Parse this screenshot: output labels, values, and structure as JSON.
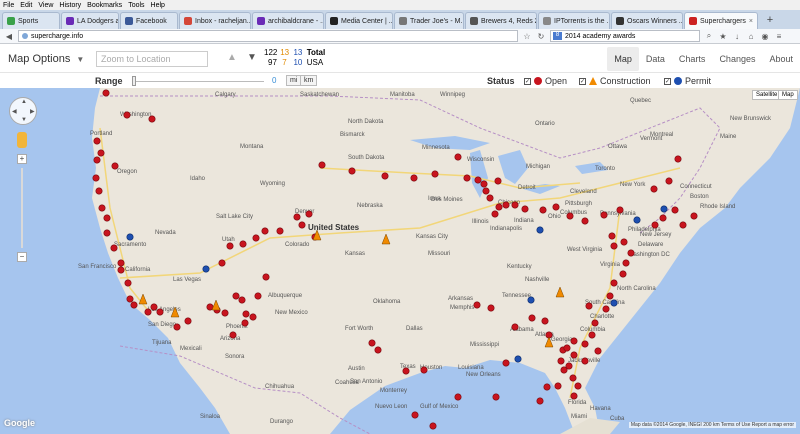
{
  "menu": [
    "File",
    "Edit",
    "View",
    "History",
    "Bookmarks",
    "Tools",
    "Help"
  ],
  "tabs": [
    {
      "label": "Sports",
      "color": "#3aa14a"
    },
    {
      "label": "LA Dodgers at Ch...",
      "color": "#6a2bb6"
    },
    {
      "label": "Facebook",
      "color": "#3b5998"
    },
    {
      "label": "Inbox - racheljan...",
      "color": "#d44638"
    },
    {
      "label": "archibaldcrane - ...",
      "color": "#6a2bb6"
    },
    {
      "label": "Media Center | ...",
      "color": "#222222"
    },
    {
      "label": "Trader Joe's - M...",
      "color": "#777777"
    },
    {
      "label": "Brewers 4, Reds 2...",
      "color": "#555555"
    },
    {
      "label": "IPTorrents is the ...",
      "color": "#888888"
    },
    {
      "label": "Oscars Winners ...",
      "color": "#333333"
    },
    {
      "label": "Superchargers",
      "color": "#cc2222"
    }
  ],
  "url": "supercharge.info",
  "search_value": "2014 academy awards",
  "app": {
    "map_options": "Map Options",
    "zoom_placeholder": "Zoom to Location",
    "counts": {
      "row1": [
        "122",
        "13",
        "13",
        "Total"
      ],
      "row2": [
        "97",
        "7",
        "10",
        "USA"
      ]
    },
    "nav": [
      "Map",
      "Data",
      "Charts",
      "Changes",
      "About"
    ],
    "range_label": "Range",
    "range_value": "0",
    "units": [
      "mi",
      "km"
    ],
    "status_label": "Status",
    "status": [
      "Open",
      "Construction",
      "Permit"
    ]
  },
  "colors": {
    "open": "#c8141e",
    "construction": "#f08a00",
    "permit": "#1e4fb0",
    "accent_blue": "#3a8fd6"
  },
  "map": {
    "types": [
      "Satellite",
      "Map"
    ],
    "labels": [
      "Washington",
      "Portland",
      "Oregon",
      "Idaho",
      "Montana",
      "Wyoming",
      "Nevada",
      "Utah",
      "Colorado",
      "California",
      "Sacramento",
      "San Francisco",
      "Las Vegas",
      "Los Angeles",
      "San Diego",
      "Arizona",
      "Phoenix",
      "New Mexico",
      "Albuquerque",
      "North Dakota",
      "South Dakota",
      "Nebraska",
      "Kansas",
      "Oklahoma",
      "Texas",
      "Dallas",
      "Fort Worth",
      "Austin",
      "San Antonio",
      "Houston",
      "Minnesota",
      "Iowa",
      "Missouri",
      "Wisconsin",
      "Michigan",
      "Illinois",
      "Chicago",
      "Indiana",
      "Ohio",
      "Kentucky",
      "Tennessee",
      "Arkansas",
      "Mississippi",
      "Alabama",
      "Georgia",
      "Atlanta",
      "Florida",
      "Jacksonville",
      "Miami",
      "South Carolina",
      "North Carolina",
      "Virginia",
      "West Virginia",
      "Pennsylvania",
      "New York",
      "Maine",
      "Vermont",
      "New Brunswick",
      "Quebec",
      "Ottawa",
      "Montreal",
      "Toronto",
      "Ontario",
      "Detroit",
      "Denver",
      "Kansas City",
      "Memphis",
      "Nashville",
      "Louisiana",
      "New Orleans",
      "Philadelphia",
      "Washington DC",
      "Boston",
      "Rhode Island",
      "New Jersey",
      "Delaware",
      "Connecticut",
      "Manitoba",
      "Saskatchewan",
      "Sonora",
      "Chihuahua",
      "Coahuila",
      "Nuevo Leon",
      "Durango",
      "Sinaloa",
      "Monterrey",
      "Mexicali",
      "Tijuana",
      "Salt Lake City",
      "United States",
      "Bismarck",
      "Des Moines",
      "Indianapolis",
      "Columbus",
      "Cleveland",
      "Pittsburgh",
      "Charlotte",
      "Columbia",
      "Calgary",
      "Winnipeg",
      "Gulf of Mexico",
      "Havana",
      "Cuba"
    ],
    "attribution": "Map data ©2014 Google, INEGI   200 km   Terms of Use   Report a map error",
    "google": "Google"
  },
  "markers": {
    "open": [
      [
        106,
        5
      ],
      [
        127,
        27
      ],
      [
        152,
        31
      ],
      [
        97,
        53
      ],
      [
        101,
        65
      ],
      [
        97,
        72
      ],
      [
        96,
        90
      ],
      [
        115,
        78
      ],
      [
        99,
        103
      ],
      [
        102,
        120
      ],
      [
        107,
        130
      ],
      [
        107,
        145
      ],
      [
        114,
        160
      ],
      [
        121,
        175
      ],
      [
        121,
        182
      ],
      [
        128,
        195
      ],
      [
        130,
        211
      ],
      [
        134,
        217
      ],
      [
        148,
        224
      ],
      [
        154,
        219
      ],
      [
        160,
        224
      ],
      [
        188,
        233
      ],
      [
        177,
        239
      ],
      [
        210,
        219
      ],
      [
        217,
        222
      ],
      [
        225,
        225
      ],
      [
        236,
        208
      ],
      [
        242,
        212
      ],
      [
        246,
        226
      ],
      [
        233,
        247
      ],
      [
        245,
        235
      ],
      [
        253,
        229
      ],
      [
        258,
        208
      ],
      [
        266,
        189
      ],
      [
        222,
        175
      ],
      [
        230,
        158
      ],
      [
        243,
        156
      ],
      [
        256,
        150
      ],
      [
        265,
        143
      ],
      [
        280,
        143
      ],
      [
        297,
        129
      ],
      [
        302,
        137
      ],
      [
        309,
        126
      ],
      [
        315,
        149
      ],
      [
        322,
        77
      ],
      [
        352,
        83
      ],
      [
        385,
        88
      ],
      [
        414,
        90
      ],
      [
        435,
        86
      ],
      [
        458,
        69
      ],
      [
        467,
        90
      ],
      [
        478,
        92
      ],
      [
        484,
        96
      ],
      [
        498,
        93
      ],
      [
        486,
        103
      ],
      [
        490,
        110
      ],
      [
        499,
        119
      ],
      [
        495,
        126
      ],
      [
        506,
        117
      ],
      [
        515,
        117
      ],
      [
        525,
        121
      ],
      [
        543,
        122
      ],
      [
        556,
        119
      ],
      [
        570,
        128
      ],
      [
        585,
        133
      ],
      [
        604,
        127
      ],
      [
        612,
        148
      ],
      [
        614,
        158
      ],
      [
        624,
        154
      ],
      [
        631,
        165
      ],
      [
        626,
        175
      ],
      [
        623,
        186
      ],
      [
        614,
        195
      ],
      [
        610,
        208
      ],
      [
        606,
        221
      ],
      [
        595,
        235
      ],
      [
        592,
        247
      ],
      [
        585,
        256
      ],
      [
        574,
        267
      ],
      [
        564,
        282
      ],
      [
        547,
        299
      ],
      [
        578,
        298
      ],
      [
        574,
        308
      ],
      [
        558,
        298
      ],
      [
        540,
        313
      ],
      [
        549,
        247
      ],
      [
        545,
        233
      ],
      [
        532,
        230
      ],
      [
        515,
        239
      ],
      [
        491,
        220
      ],
      [
        477,
        217
      ],
      [
        506,
        275
      ],
      [
        496,
        309
      ],
      [
        458,
        309
      ],
      [
        415,
        327
      ],
      [
        406,
        283
      ],
      [
        372,
        255
      ],
      [
        378,
        262
      ],
      [
        424,
        282
      ],
      [
        433,
        338
      ],
      [
        573,
        290
      ],
      [
        585,
        273
      ],
      [
        598,
        263
      ],
      [
        620,
        122
      ],
      [
        655,
        137
      ],
      [
        675,
        122
      ],
      [
        683,
        137
      ],
      [
        694,
        128
      ],
      [
        669,
        93
      ],
      [
        678,
        71
      ],
      [
        654,
        101
      ],
      [
        663,
        130
      ],
      [
        563,
        262
      ],
      [
        569,
        278
      ],
      [
        561,
        273
      ],
      [
        574,
        253
      ],
      [
        567,
        260
      ],
      [
        589,
        218
      ]
    ],
    "construction": [
      [
        143,
        212
      ],
      [
        175,
        225
      ],
      [
        216,
        218
      ],
      [
        317,
        148
      ],
      [
        386,
        152
      ],
      [
        560,
        205
      ],
      [
        549,
        255
      ]
    ],
    "permit": [
      [
        130,
        149
      ],
      [
        206,
        181
      ],
      [
        540,
        142
      ],
      [
        614,
        215
      ],
      [
        637,
        132
      ],
      [
        664,
        121
      ],
      [
        531,
        212
      ],
      [
        518,
        271
      ]
    ]
  }
}
